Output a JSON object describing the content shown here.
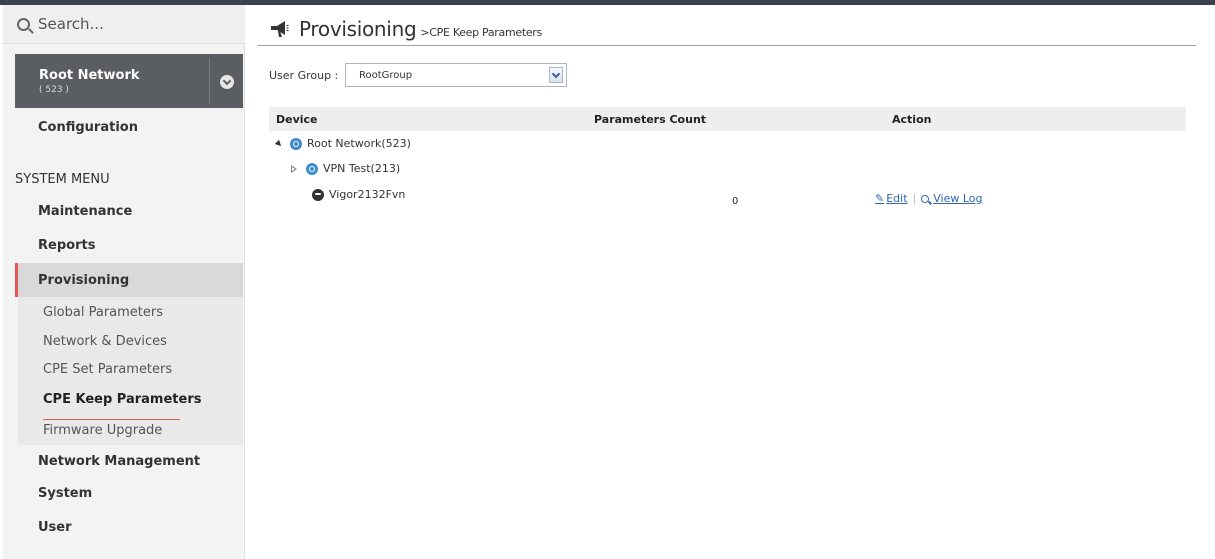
{
  "search": {
    "placeholder": "Search..."
  },
  "root_network": {
    "name": "Root Network",
    "count": "( 523 )"
  },
  "sidebar": {
    "configuration": "Configuration",
    "system_menu_label": "SYSTEM MENU",
    "items": [
      "Maintenance",
      "Reports",
      "Provisioning",
      "Network Management",
      "System",
      "User"
    ],
    "provisioning_sub": [
      "Global Parameters",
      "Network & Devices",
      "CPE Set Parameters",
      "CPE Keep Parameters",
      "Firmware Upgrade"
    ],
    "active_sub": "CPE Keep Parameters"
  },
  "header": {
    "title": "Provisioning",
    "subtitle": ">CPE Keep Parameters"
  },
  "user_group": {
    "label": "User Group :",
    "value": "RootGroup"
  },
  "table": {
    "columns": [
      "Device",
      "Parameters Count",
      "Action"
    ],
    "rows": [
      {
        "device": "Root Network(523)",
        "count": "",
        "level": 0,
        "icon": "network-icon"
      },
      {
        "device": "VPN Test(213)",
        "count": "",
        "level": 1,
        "icon": "network-icon"
      },
      {
        "device": "Vigor2132Fvn",
        "count": "0",
        "level": 1,
        "icon": "device-icon",
        "actions": [
          "Edit",
          "View Log"
        ]
      }
    ]
  },
  "colors": {
    "accent": "#e45a5a",
    "link": "#2f67b1",
    "network_icon": "#3c8ccc",
    "sidebar_bg": "#f3f3f3"
  }
}
